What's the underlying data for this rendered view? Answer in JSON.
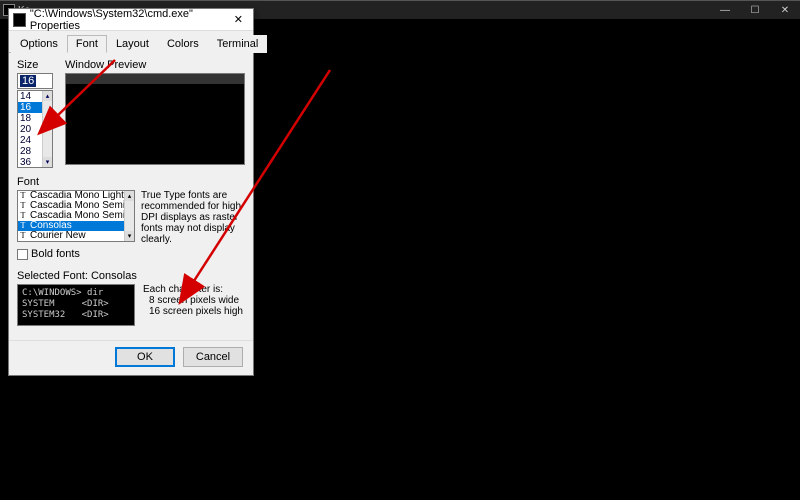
{
  "cmd_window": {
    "title_prefix": "Ko",
    "controls": {
      "minimize": "—",
      "maximize": "☐",
      "close": "✕"
    }
  },
  "dialog": {
    "title": "\"C:\\Windows\\System32\\cmd.exe\" Properties",
    "close_label": "✕",
    "tabs": [
      "Options",
      "Font",
      "Layout",
      "Colors",
      "Terminal"
    ],
    "active_tab": 1,
    "size_label": "Size",
    "size_selected": "16",
    "size_options": [
      "14",
      "16",
      "18",
      "20",
      "24",
      "28",
      "36"
    ],
    "preview_label": "Window Preview",
    "font_label": "Font",
    "fonts": [
      "Cascadia Mono Light",
      "Cascadia Mono SemiBold",
      "Cascadia Mono SemiLight",
      "Consolas",
      "Courier New"
    ],
    "font_selected_index": 3,
    "truetype_hint": "True Type fonts are recommended for high DPI displays as raster fonts may not display clearly.",
    "bold_label": "Bold fonts",
    "bold_checked": false,
    "selected_font_label": "Selected Font: Consolas",
    "sample_text": "C:\\WINDOWS> dir\nSYSTEM     <DIR>\nSYSTEM32   <DIR>",
    "char_info_header": "Each character is:",
    "char_info_width": "8 screen pixels wide",
    "char_info_height": "16 screen pixels high",
    "ok_label": "OK",
    "cancel_label": "Cancel"
  },
  "annotation": {
    "color": "#d40000"
  }
}
